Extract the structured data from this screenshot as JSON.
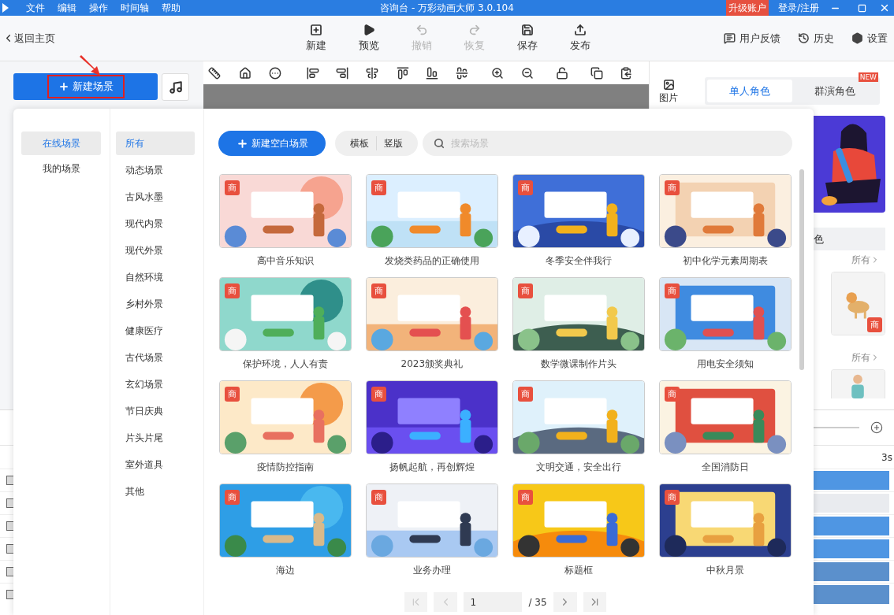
{
  "title_bar": {
    "menus": [
      "文件",
      "编辑",
      "操作",
      "时间轴",
      "帮助"
    ],
    "title": "咨询台 - 万彩动画大师 3.0.104",
    "upgrade": "升级账户",
    "login": "登录/注册"
  },
  "toolbar": {
    "back": "返回主页",
    "actions": [
      {
        "label": "新建",
        "disabled": false
      },
      {
        "label": "预览",
        "disabled": false
      },
      {
        "label": "撤销",
        "disabled": true
      },
      {
        "label": "恢复",
        "disabled": true
      },
      {
        "label": "保存",
        "disabled": false
      },
      {
        "label": "发布",
        "disabled": false
      }
    ],
    "right": [
      "用户反馈",
      "历史",
      "设置"
    ]
  },
  "new_scene_button": "新建场景",
  "side_tab": "图片",
  "right_panel": {
    "tabs": [
      {
        "label": "单人角色",
        "selected": true
      },
      {
        "label": "群演角色",
        "selected": false,
        "badge": "NEW"
      }
    ],
    "partial_tab": "色",
    "more_links": [
      "所有",
      "所有"
    ],
    "sticker_badge": "商"
  },
  "timeline": {
    "ruler_label": "3s"
  },
  "dialog": {
    "sources": [
      {
        "label": "在线场景",
        "selected": true
      },
      {
        "label": "我的场景",
        "selected": false
      }
    ],
    "categories": [
      {
        "label": "所有",
        "selected": true
      },
      {
        "label": "动态场景",
        "selected": false
      },
      {
        "label": "古风水墨",
        "selected": false
      },
      {
        "label": "现代内景",
        "selected": false
      },
      {
        "label": "现代外景",
        "selected": false
      },
      {
        "label": "自然环境",
        "selected": false
      },
      {
        "label": "乡村外景",
        "selected": false
      },
      {
        "label": "健康医疗",
        "selected": false
      },
      {
        "label": "古代场景",
        "selected": false
      },
      {
        "label": "玄幻场景",
        "selected": false
      },
      {
        "label": "节日庆典",
        "selected": false
      },
      {
        "label": "片头片尾",
        "selected": false
      },
      {
        "label": "室外道具",
        "selected": false
      },
      {
        "label": "其他",
        "selected": false
      }
    ],
    "new_blank": "新建空白场景",
    "orientations": [
      "横板",
      "竖版"
    ],
    "search": {
      "placeholder": "搜索场景"
    },
    "scenes": [
      {
        "title": "高中音乐知识",
        "badge": "商"
      },
      {
        "title": "发烧类药品的正确使用",
        "badge": "商"
      },
      {
        "title": "冬季安全伴我行",
        "badge": "商"
      },
      {
        "title": "初中化学元素周期表",
        "badge": "商"
      },
      {
        "title": "保护环境，人人有责",
        "badge": "商"
      },
      {
        "title": "2023颁奖典礼",
        "badge": "商"
      },
      {
        "title": "数学微课制作片头",
        "badge": "商"
      },
      {
        "title": "用电安全须知",
        "badge": "商"
      },
      {
        "title": "疫情防控指南",
        "badge": "商"
      },
      {
        "title": "扬帆起航，再创辉煌",
        "badge": "商"
      },
      {
        "title": "文明交通，安全出行",
        "badge": "商"
      },
      {
        "title": "全国消防日",
        "badge": "商"
      },
      {
        "title": "海边",
        "badge": "商"
      },
      {
        "title": "业务办理",
        "badge": "商"
      },
      {
        "title": "标题框",
        "badge": "商"
      },
      {
        "title": "中秋月景",
        "badge": "商"
      }
    ],
    "pagination": {
      "page": "1",
      "total": "/ 35"
    }
  }
}
